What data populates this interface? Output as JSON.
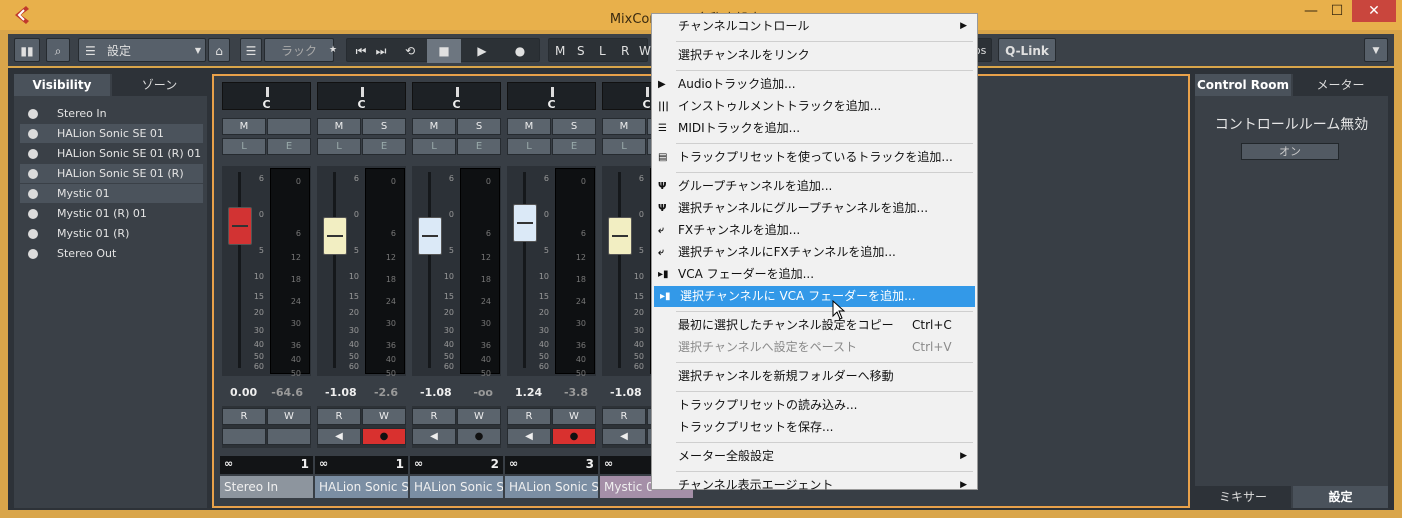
{
  "window": {
    "title": "MixConsole - 名称未設定1",
    "controls": [
      "—",
      "☐",
      "✕"
    ]
  },
  "toolbar": {
    "config_label": "設定",
    "rack_label": "ラック",
    "star": "★",
    "qlink_label": "Q-Link",
    "routing_labels": [
      "M",
      "S",
      "L",
      "R",
      "W"
    ],
    "bs_label": "bs"
  },
  "left_panel": {
    "tabs": [
      "Visibility",
      "ゾーン"
    ],
    "items": [
      "Stereo In",
      "HALion Sonic SE 01",
      "HALion Sonic SE 01 (R) 01",
      "HALion Sonic SE 01 (R)",
      "Mystic 01",
      "Mystic 01 (R) 01",
      "Mystic 01 (R)",
      "Stereo Out"
    ]
  },
  "channels": [
    {
      "pan": "C",
      "btn_top": [
        "M",
        ""
      ],
      "btn_bottom": [
        "L",
        "E"
      ],
      "val_a": "0.00",
      "val_b": "-64.6",
      "num": "1",
      "name": "Stereo In",
      "fader_color": "#d23333",
      "fader_level": 0.22,
      "rec": false
    },
    {
      "pan": "C",
      "btn_top": [
        "M",
        "S"
      ],
      "btn_bottom": [
        "L",
        "E"
      ],
      "val_a": "-1.08",
      "val_b": "-2.6",
      "num": "1",
      "name": "HALion Sonic S",
      "fader_color": "#f2eec2",
      "fader_level": 0.28,
      "rec": true
    },
    {
      "pan": "C",
      "btn_top": [
        "M",
        "S"
      ],
      "btn_bottom": [
        "L",
        "E"
      ],
      "val_a": "-1.08",
      "val_b": "-oo",
      "num": "2",
      "name": "HALion Sonic S",
      "fader_color": "#dbe9f7",
      "fader_level": 0.28,
      "rec": false
    },
    {
      "pan": "C",
      "btn_top": [
        "M",
        "S"
      ],
      "btn_bottom": [
        "L",
        "E"
      ],
      "val_a": "1.24",
      "val_b": "-3.8",
      "num": "3",
      "name": "HALion Sonic S",
      "fader_color": "#dbe9f7",
      "fader_level": 0.2,
      "rec": true
    },
    {
      "pan": "C",
      "btn_top": [
        "M",
        ""
      ],
      "btn_bottom": [
        "L",
        ""
      ],
      "val_a": "-1.08",
      "val_b": "",
      "num": "",
      "name": "Mystic 0",
      "fader_color": "#f2eec2",
      "fader_level": 0.28,
      "rec": false
    }
  ],
  "meter_scale": [
    "6",
    "0",
    "5",
    "10",
    "15",
    "20",
    "30",
    "40",
    "50",
    "60"
  ],
  "meter_scale_right": [
    "0",
    "6",
    "12",
    "18",
    "24",
    "30",
    "36",
    "40",
    "50"
  ],
  "rw_labels": [
    "R",
    "W"
  ],
  "right_panel": {
    "tabs": [
      "Control Room",
      "メーター"
    ],
    "heading": "コントロールルーム無効",
    "on_button": "オン",
    "bottom_tabs": [
      "ミキサー",
      "設定"
    ]
  },
  "menu": {
    "items": [
      {
        "label": "チャンネルコントロール",
        "submenu": true
      },
      {
        "sep": true
      },
      {
        "label": "選択チャンネルをリンク"
      },
      {
        "sep": true
      },
      {
        "label": "Audioトラック追加...",
        "icon": "audio-track-icon"
      },
      {
        "label": "インストゥルメントトラックを追加...",
        "icon": "instrument-track-icon"
      },
      {
        "label": "MIDIトラックを追加...",
        "icon": "midi-track-icon"
      },
      {
        "sep": true
      },
      {
        "label": "トラックプリセットを使っているトラックを追加...",
        "icon": "track-preset-icon"
      },
      {
        "sep": true
      },
      {
        "label": "グループチャンネルを追加...",
        "icon": "group-channel-icon"
      },
      {
        "label": "選択チャンネルにグループチャンネルを追加...",
        "icon": "group-channel-icon"
      },
      {
        "label": "FXチャンネルを追加...",
        "icon": "fx-channel-icon"
      },
      {
        "label": "選択チャンネルにFXチャンネルを追加...",
        "icon": "fx-channel-icon"
      },
      {
        "label": "VCA フェーダーを追加...",
        "icon": "vca-fader-icon"
      },
      {
        "label": "選択チャンネルに VCA フェーダーを追加...",
        "icon": "vca-fader-icon",
        "highlight": true
      },
      {
        "sep": true
      },
      {
        "label": "最初に選択したチャンネル設定をコピー",
        "shortcut": "Ctrl+C"
      },
      {
        "label": "選択チャンネルへ設定をペースト",
        "shortcut": "Ctrl+V",
        "disabled": true
      },
      {
        "sep": true
      },
      {
        "label": "選択チャンネルを新規フォルダーへ移動"
      },
      {
        "sep": true
      },
      {
        "label": "トラックプリセットの読み込み..."
      },
      {
        "label": "トラックプリセットを保存..."
      },
      {
        "sep": true
      },
      {
        "label": "メーター全般設定",
        "submenu": true
      },
      {
        "sep": true
      },
      {
        "label": "チャンネル表示エージェント",
        "submenu": true
      }
    ]
  },
  "colors": {
    "accent": "#e8a14a",
    "highlight": "#3399e8",
    "record": "#d9312f"
  }
}
